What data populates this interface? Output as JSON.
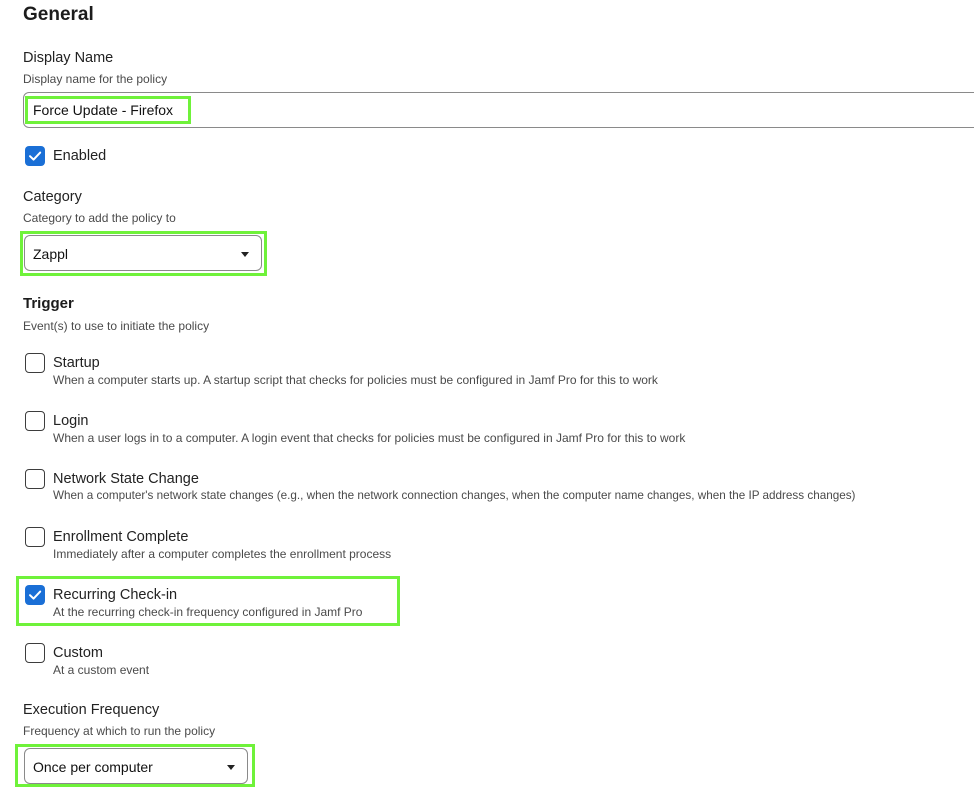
{
  "section_title": "General",
  "display_name": {
    "label": "Display Name",
    "description": "Display name for the policy",
    "value": "Force Update - Firefox"
  },
  "enabled": {
    "label": "Enabled",
    "checked": true
  },
  "category": {
    "label": "Category",
    "description": "Category to add the policy to",
    "selected": "Zappl"
  },
  "trigger": {
    "title": "Trigger",
    "description": "Event(s) to use to initiate the policy",
    "options": [
      {
        "label": "Startup",
        "description": "When a computer starts up. A startup script that checks for policies must be configured in Jamf Pro for this to work",
        "checked": false
      },
      {
        "label": "Login",
        "description": "When a user logs in to a computer. A login event that checks for policies must be configured in Jamf Pro for this to work",
        "checked": false
      },
      {
        "label": "Network State Change",
        "description": "When a computer's network state changes (e.g., when the network connection changes, when the computer name changes, when the IP address changes)",
        "checked": false
      },
      {
        "label": "Enrollment Complete",
        "description": "Immediately after a computer completes the enrollment process",
        "checked": false
      },
      {
        "label": "Recurring Check-in",
        "description": "At the recurring check-in frequency configured in Jamf Pro",
        "checked": true
      },
      {
        "label": "Custom",
        "description": "At a custom event",
        "checked": false
      }
    ]
  },
  "execution_frequency": {
    "label": "Execution Frequency",
    "description": "Frequency at which to run the policy",
    "selected": "Once per computer"
  },
  "colors": {
    "highlight": "#6ff23a",
    "checkbox_checked": "#1a6fd6",
    "input_border": "#8a8a8a"
  }
}
